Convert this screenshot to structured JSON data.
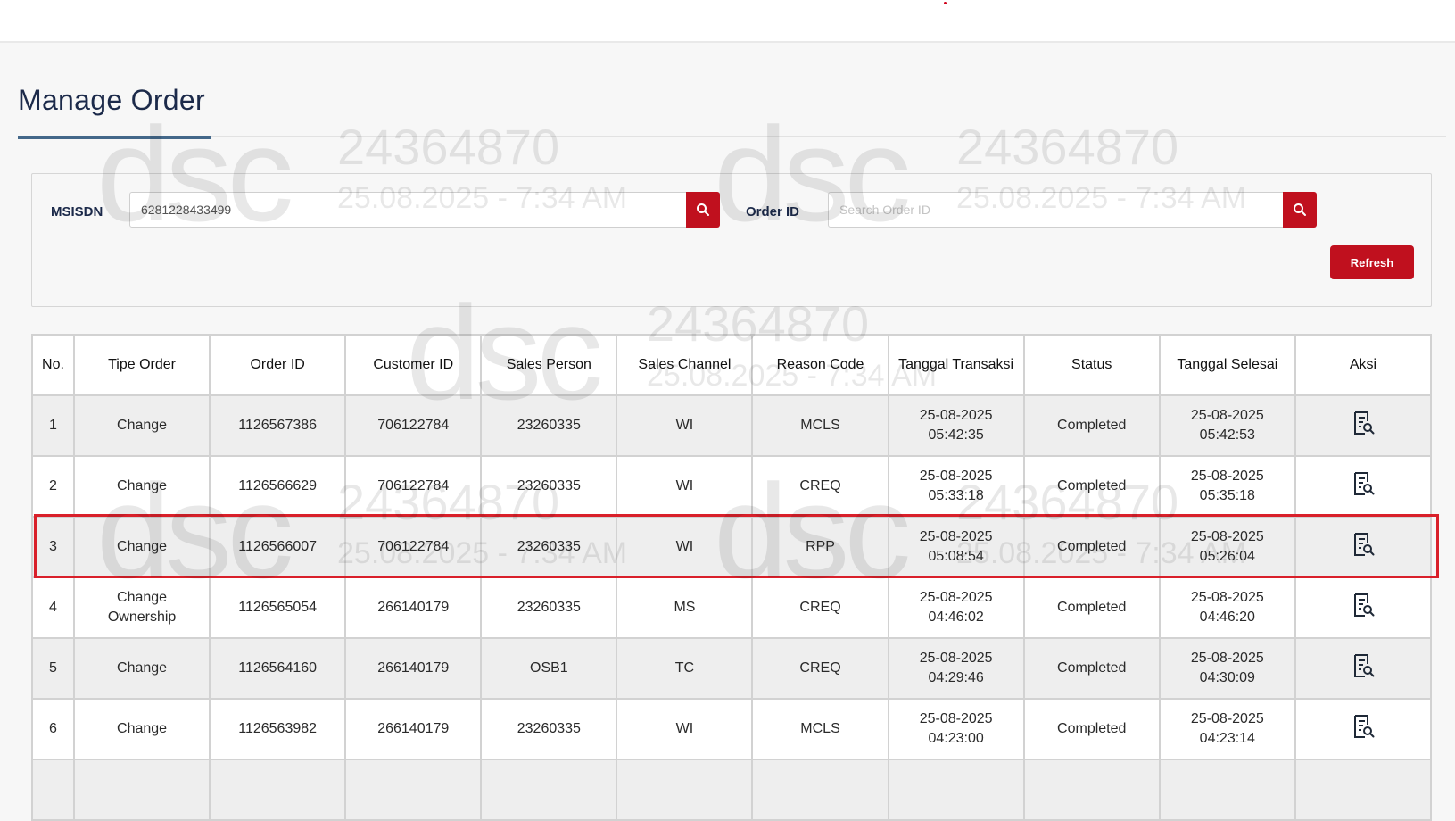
{
  "page": {
    "title": "Manage Order"
  },
  "filters": {
    "msisdn_label": "MSISDN",
    "msisdn_value": "6281228433499",
    "orderid_label": "Order ID",
    "orderid_placeholder": "Search Order ID",
    "refresh_label": "Refresh",
    "search_icon": "search-icon"
  },
  "watermark": {
    "logo": "dsc",
    "id": "24364870",
    "datetime": "25.08.2025 - 7:34 AM"
  },
  "table": {
    "headers": [
      "No.",
      "Tipe Order",
      "Order ID",
      "Customer ID",
      "Sales Person",
      "Sales Channel",
      "Reason Code",
      "Tanggal Transaksi",
      "Status",
      "Tanggal Selesai",
      "Aksi"
    ],
    "action_icon": "document-search-icon",
    "rows": [
      {
        "no": "1",
        "tipe": "Change",
        "order_id": "1126567386",
        "customer_id": "706122784",
        "sales_person": "23260335",
        "sales_channel": "WI",
        "reason": "MCLS",
        "trx_date": "25-08-2025",
        "trx_time": "05:42:35",
        "status": "Completed",
        "done_date": "25-08-2025",
        "done_time": "05:42:53"
      },
      {
        "no": "2",
        "tipe": "Change",
        "order_id": "1126566629",
        "customer_id": "706122784",
        "sales_person": "23260335",
        "sales_channel": "WI",
        "reason": "CREQ",
        "trx_date": "25-08-2025",
        "trx_time": "05:33:18",
        "status": "Completed",
        "done_date": "25-08-2025",
        "done_time": "05:35:18"
      },
      {
        "no": "3",
        "tipe": "Change",
        "order_id": "1126566007",
        "customer_id": "706122784",
        "sales_person": "23260335",
        "sales_channel": "WI",
        "reason": "RPP",
        "trx_date": "25-08-2025",
        "trx_time": "05:08:54",
        "status": "Completed",
        "done_date": "25-08-2025",
        "done_time": "05:26:04"
      },
      {
        "no": "4",
        "tipe": "Change Ownership",
        "order_id": "1126565054",
        "customer_id": "266140179",
        "sales_person": "23260335",
        "sales_channel": "MS",
        "reason": "CREQ",
        "trx_date": "25-08-2025",
        "trx_time": "04:46:02",
        "status": "Completed",
        "done_date": "25-08-2025",
        "done_time": "04:46:20"
      },
      {
        "no": "5",
        "tipe": "Change",
        "order_id": "1126564160",
        "customer_id": "266140179",
        "sales_person": "OSB1",
        "sales_channel": "TC",
        "reason": "CREQ",
        "trx_date": "25-08-2025",
        "trx_time": "04:29:46",
        "status": "Completed",
        "done_date": "25-08-2025",
        "done_time": "04:30:09"
      },
      {
        "no": "6",
        "tipe": "Change",
        "order_id": "1126563982",
        "customer_id": "266140179",
        "sales_person": "23260335",
        "sales_channel": "WI",
        "reason": "MCLS",
        "trx_date": "25-08-2025",
        "trx_time": "04:23:00",
        "status": "Completed",
        "done_date": "25-08-2025",
        "done_time": "04:23:14"
      }
    ],
    "highlighted_row": "3"
  },
  "colors": {
    "accent": "#c0101e",
    "title": "#1c2a4a",
    "highlight_border": "#d9202a"
  }
}
